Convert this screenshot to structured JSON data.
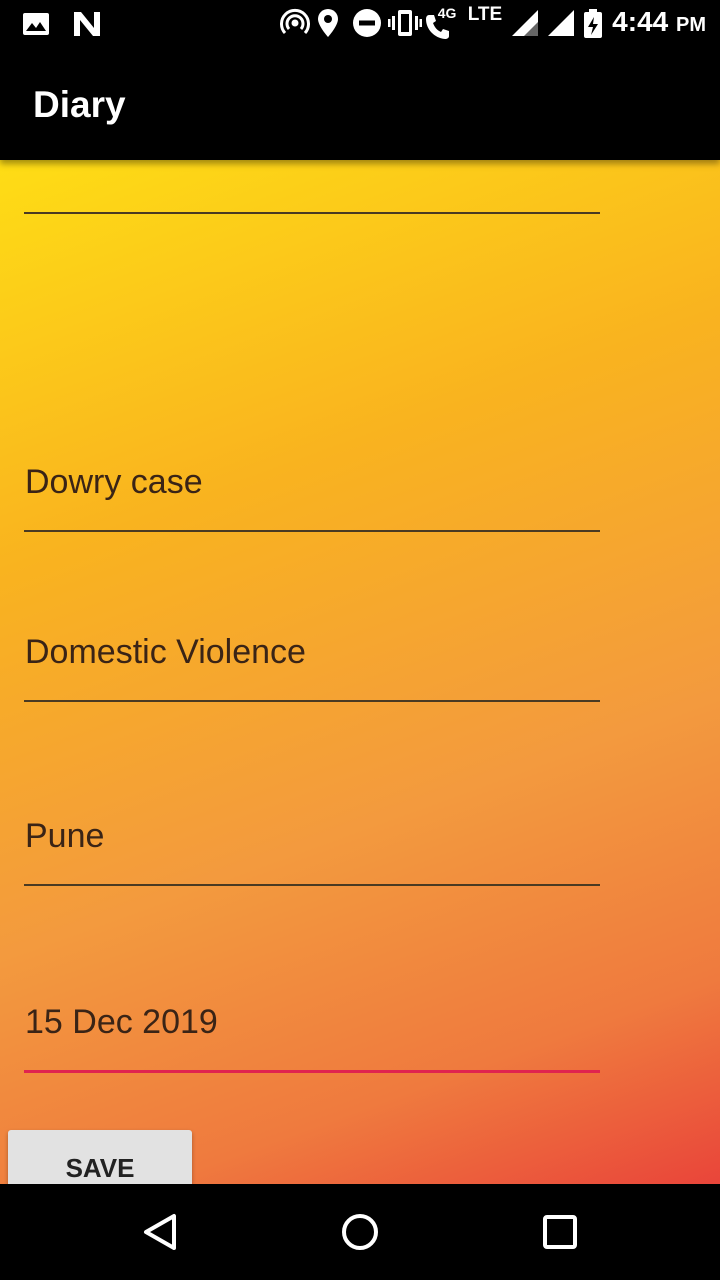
{
  "status_bar": {
    "network_label": "4G",
    "lte_label": "LTE",
    "time": "4:44",
    "ampm": "PM",
    "icons": [
      "image-icon",
      "n-logo-icon",
      "hotspot-icon",
      "location-icon",
      "do-not-disturb-icon",
      "vibrate-icon",
      "wifi-call-icon",
      "signal-icon",
      "signal-icon",
      "battery-charging-icon"
    ]
  },
  "app_bar": {
    "title": "Diary"
  },
  "form": {
    "fields": [
      {
        "value": ""
      },
      {
        "value": "Dowry case"
      },
      {
        "value": "Domestic Violence"
      },
      {
        "value": "Pune"
      },
      {
        "value": "15 Dec 2019"
      }
    ],
    "save_label": "SAVE"
  },
  "nav_bar": {
    "icons": [
      "back-icon",
      "home-icon",
      "recents-icon"
    ]
  },
  "colors": {
    "gradient_top": "#fedd15",
    "gradient_bottom": "#e9453a",
    "active_underline": "#e0244f",
    "bar_background": "#000000"
  }
}
